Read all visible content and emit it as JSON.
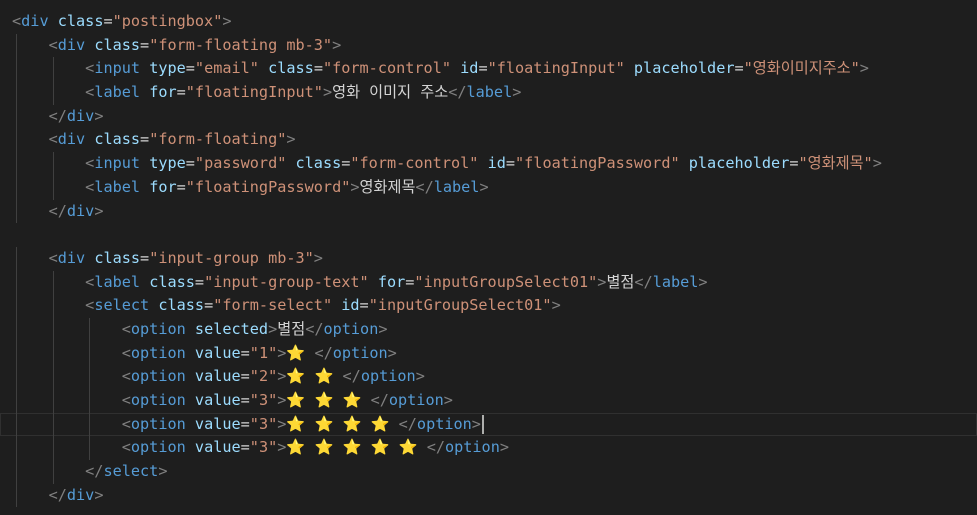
{
  "editor": {
    "theme": {
      "background": "#1e1e1e",
      "tag": "#569cd6",
      "attr": "#9cdcfe",
      "value": "#ce9178",
      "punct": "#808080",
      "text": "#d4d4d4",
      "emoji": "#ffc83d"
    },
    "cursor_line": 17,
    "lines": [
      [
        {
          "t": "punct",
          "v": "<"
        },
        {
          "t": "tag",
          "v": "div"
        },
        {
          "t": "text",
          "v": " "
        },
        {
          "t": "attr",
          "v": "class"
        },
        {
          "t": "text",
          "v": "="
        },
        {
          "t": "val",
          "v": "\"postingbox\""
        },
        {
          "t": "punct",
          "v": ">"
        }
      ],
      [
        {
          "t": "punct",
          "v": "<"
        },
        {
          "t": "tag",
          "v": "div"
        },
        {
          "t": "text",
          "v": " "
        },
        {
          "t": "attr",
          "v": "class"
        },
        {
          "t": "text",
          "v": "="
        },
        {
          "t": "val",
          "v": "\"form-floating mb-3\""
        },
        {
          "t": "punct",
          "v": ">"
        }
      ],
      [
        {
          "t": "punct",
          "v": "<"
        },
        {
          "t": "tag",
          "v": "input"
        },
        {
          "t": "text",
          "v": " "
        },
        {
          "t": "attr",
          "v": "type"
        },
        {
          "t": "text",
          "v": "="
        },
        {
          "t": "val",
          "v": "\"email\""
        },
        {
          "t": "text",
          "v": " "
        },
        {
          "t": "attr",
          "v": "class"
        },
        {
          "t": "text",
          "v": "="
        },
        {
          "t": "val",
          "v": "\"form-control\""
        },
        {
          "t": "text",
          "v": " "
        },
        {
          "t": "attr",
          "v": "id"
        },
        {
          "t": "text",
          "v": "="
        },
        {
          "t": "val",
          "v": "\"floatingInput\""
        },
        {
          "t": "text",
          "v": " "
        },
        {
          "t": "attr",
          "v": "placeholder"
        },
        {
          "t": "text",
          "v": "="
        },
        {
          "t": "val",
          "v": "\"영화이미지주소\""
        },
        {
          "t": "punct",
          "v": ">"
        }
      ],
      [
        {
          "t": "punct",
          "v": "<"
        },
        {
          "t": "tag",
          "v": "label"
        },
        {
          "t": "text",
          "v": " "
        },
        {
          "t": "attr",
          "v": "for"
        },
        {
          "t": "text",
          "v": "="
        },
        {
          "t": "val",
          "v": "\"floatingInput\""
        },
        {
          "t": "punct",
          "v": ">"
        },
        {
          "t": "text",
          "v": "영화 이미지 주소"
        },
        {
          "t": "punct",
          "v": "</"
        },
        {
          "t": "tag",
          "v": "label"
        },
        {
          "t": "punct",
          "v": ">"
        }
      ],
      [
        {
          "t": "punct",
          "v": "</"
        },
        {
          "t": "tag",
          "v": "div"
        },
        {
          "t": "punct",
          "v": ">"
        }
      ],
      [
        {
          "t": "punct",
          "v": "<"
        },
        {
          "t": "tag",
          "v": "div"
        },
        {
          "t": "text",
          "v": " "
        },
        {
          "t": "attr",
          "v": "class"
        },
        {
          "t": "text",
          "v": "="
        },
        {
          "t": "val",
          "v": "\"form-floating\""
        },
        {
          "t": "punct",
          "v": ">"
        }
      ],
      [
        {
          "t": "punct",
          "v": "<"
        },
        {
          "t": "tag",
          "v": "input"
        },
        {
          "t": "text",
          "v": " "
        },
        {
          "t": "attr",
          "v": "type"
        },
        {
          "t": "text",
          "v": "="
        },
        {
          "t": "val",
          "v": "\"password\""
        },
        {
          "t": "text",
          "v": " "
        },
        {
          "t": "attr",
          "v": "class"
        },
        {
          "t": "text",
          "v": "="
        },
        {
          "t": "val",
          "v": "\"form-control\""
        },
        {
          "t": "text",
          "v": " "
        },
        {
          "t": "attr",
          "v": "id"
        },
        {
          "t": "text",
          "v": "="
        },
        {
          "t": "val",
          "v": "\"floatingPassword\""
        },
        {
          "t": "text",
          "v": " "
        },
        {
          "t": "attr",
          "v": "placeholder"
        },
        {
          "t": "text",
          "v": "="
        },
        {
          "t": "val",
          "v": "\"영화제목\""
        },
        {
          "t": "punct",
          "v": ">"
        }
      ],
      [
        {
          "t": "punct",
          "v": "<"
        },
        {
          "t": "tag",
          "v": "label"
        },
        {
          "t": "text",
          "v": " "
        },
        {
          "t": "attr",
          "v": "for"
        },
        {
          "t": "text",
          "v": "="
        },
        {
          "t": "val",
          "v": "\"floatingPassword\""
        },
        {
          "t": "punct",
          "v": ">"
        },
        {
          "t": "text",
          "v": "영화제목"
        },
        {
          "t": "punct",
          "v": "</"
        },
        {
          "t": "tag",
          "v": "label"
        },
        {
          "t": "punct",
          "v": ">"
        }
      ],
      [
        {
          "t": "punct",
          "v": "</"
        },
        {
          "t": "tag",
          "v": "div"
        },
        {
          "t": "punct",
          "v": ">"
        }
      ],
      [],
      [
        {
          "t": "punct",
          "v": "<"
        },
        {
          "t": "tag",
          "v": "div"
        },
        {
          "t": "text",
          "v": " "
        },
        {
          "t": "attr",
          "v": "class"
        },
        {
          "t": "text",
          "v": "="
        },
        {
          "t": "val",
          "v": "\"input-group mb-3\""
        },
        {
          "t": "punct",
          "v": ">"
        }
      ],
      [
        {
          "t": "punct",
          "v": "<"
        },
        {
          "t": "tag",
          "v": "label"
        },
        {
          "t": "text",
          "v": " "
        },
        {
          "t": "attr",
          "v": "class"
        },
        {
          "t": "text",
          "v": "="
        },
        {
          "t": "val",
          "v": "\"input-group-text\""
        },
        {
          "t": "text",
          "v": " "
        },
        {
          "t": "attr",
          "v": "for"
        },
        {
          "t": "text",
          "v": "="
        },
        {
          "t": "val",
          "v": "\"inputGroupSelect01\""
        },
        {
          "t": "punct",
          "v": ">"
        },
        {
          "t": "text",
          "v": "별점"
        },
        {
          "t": "punct",
          "v": "</"
        },
        {
          "t": "tag",
          "v": "label"
        },
        {
          "t": "punct",
          "v": ">"
        }
      ],
      [
        {
          "t": "punct",
          "v": "<"
        },
        {
          "t": "tag",
          "v": "select"
        },
        {
          "t": "text",
          "v": " "
        },
        {
          "t": "attr",
          "v": "class"
        },
        {
          "t": "text",
          "v": "="
        },
        {
          "t": "val",
          "v": "\"form-select\""
        },
        {
          "t": "text",
          "v": " "
        },
        {
          "t": "attr",
          "v": "id"
        },
        {
          "t": "text",
          "v": "="
        },
        {
          "t": "val",
          "v": "\"inputGroupSelect01\""
        },
        {
          "t": "punct",
          "v": ">"
        }
      ],
      [
        {
          "t": "punct",
          "v": "<"
        },
        {
          "t": "tag",
          "v": "option"
        },
        {
          "t": "text",
          "v": " "
        },
        {
          "t": "attr",
          "v": "selected"
        },
        {
          "t": "punct",
          "v": ">"
        },
        {
          "t": "text",
          "v": "별점"
        },
        {
          "t": "punct",
          "v": "</"
        },
        {
          "t": "tag",
          "v": "option"
        },
        {
          "t": "punct",
          "v": ">"
        }
      ],
      [
        {
          "t": "punct",
          "v": "<"
        },
        {
          "t": "tag",
          "v": "option"
        },
        {
          "t": "text",
          "v": " "
        },
        {
          "t": "attr",
          "v": "value"
        },
        {
          "t": "text",
          "v": "="
        },
        {
          "t": "val",
          "v": "\"1\""
        },
        {
          "t": "punct",
          "v": ">"
        },
        {
          "t": "star",
          "v": "⭐"
        },
        {
          "t": "text",
          "v": " "
        },
        {
          "t": "punct",
          "v": "</"
        },
        {
          "t": "tag",
          "v": "option"
        },
        {
          "t": "punct",
          "v": ">"
        }
      ],
      [
        {
          "t": "punct",
          "v": "<"
        },
        {
          "t": "tag",
          "v": "option"
        },
        {
          "t": "text",
          "v": " "
        },
        {
          "t": "attr",
          "v": "value"
        },
        {
          "t": "text",
          "v": "="
        },
        {
          "t": "val",
          "v": "\"2\""
        },
        {
          "t": "punct",
          "v": ">"
        },
        {
          "t": "star",
          "v": "⭐ ⭐"
        },
        {
          "t": "text",
          "v": " "
        },
        {
          "t": "punct",
          "v": "</"
        },
        {
          "t": "tag",
          "v": "option"
        },
        {
          "t": "punct",
          "v": ">"
        }
      ],
      [
        {
          "t": "punct",
          "v": "<"
        },
        {
          "t": "tag",
          "v": "option"
        },
        {
          "t": "text",
          "v": " "
        },
        {
          "t": "attr",
          "v": "value"
        },
        {
          "t": "text",
          "v": "="
        },
        {
          "t": "val",
          "v": "\"3\""
        },
        {
          "t": "punct",
          "v": ">"
        },
        {
          "t": "star",
          "v": "⭐ ⭐ ⭐"
        },
        {
          "t": "text",
          "v": " "
        },
        {
          "t": "punct",
          "v": "</"
        },
        {
          "t": "tag",
          "v": "option"
        },
        {
          "t": "punct",
          "v": ">"
        }
      ],
      [
        {
          "t": "punct",
          "v": "<"
        },
        {
          "t": "tag",
          "v": "option"
        },
        {
          "t": "text",
          "v": " "
        },
        {
          "t": "attr",
          "v": "value"
        },
        {
          "t": "text",
          "v": "="
        },
        {
          "t": "val",
          "v": "\"3\""
        },
        {
          "t": "punct",
          "v": ">"
        },
        {
          "t": "star",
          "v": "⭐ ⭐ ⭐ ⭐"
        },
        {
          "t": "text",
          "v": " "
        },
        {
          "t": "punct",
          "v": "</"
        },
        {
          "t": "tag",
          "v": "option"
        },
        {
          "t": "punct",
          "v": ">"
        }
      ],
      [
        {
          "t": "punct",
          "v": "<"
        },
        {
          "t": "tag",
          "v": "option"
        },
        {
          "t": "text",
          "v": " "
        },
        {
          "t": "attr",
          "v": "value"
        },
        {
          "t": "text",
          "v": "="
        },
        {
          "t": "val",
          "v": "\"3\""
        },
        {
          "t": "punct",
          "v": ">"
        },
        {
          "t": "star",
          "v": "⭐ ⭐ ⭐ ⭐ ⭐"
        },
        {
          "t": "text",
          "v": " "
        },
        {
          "t": "punct",
          "v": "</"
        },
        {
          "t": "tag",
          "v": "option"
        },
        {
          "t": "punct",
          "v": ">"
        }
      ],
      [
        {
          "t": "punct",
          "v": "</"
        },
        {
          "t": "tag",
          "v": "select"
        },
        {
          "t": "punct",
          "v": ">"
        }
      ],
      [
        {
          "t": "punct",
          "v": "</"
        },
        {
          "t": "tag",
          "v": "div"
        },
        {
          "t": "punct",
          "v": ">"
        }
      ]
    ]
  }
}
